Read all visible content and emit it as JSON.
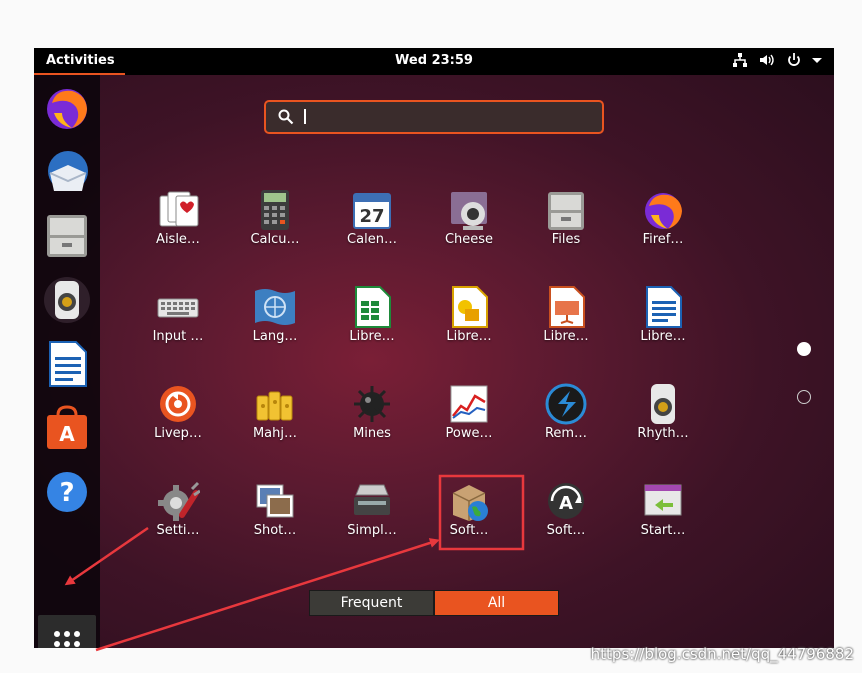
{
  "topbar": {
    "activities": "Activities",
    "clock": "Wed 23:59",
    "icons": [
      "network-icon",
      "volume-icon",
      "power-icon",
      "chevron-down-icon"
    ]
  },
  "dock": {
    "items": [
      "firefox-icon",
      "thunderbird-icon",
      "files-icon",
      "rhythmbox-icon",
      "libreoffice-writer-icon",
      "software-center-icon",
      "help-icon"
    ],
    "show_apps": "show-applications-grid-icon"
  },
  "search": {
    "placeholder": "",
    "value": ""
  },
  "apps": [
    {
      "label": "Aisle…",
      "icon": "aisleriot-icon"
    },
    {
      "label": "Calcu…",
      "icon": "calculator-icon"
    },
    {
      "label": "Calen…",
      "icon": "calendar-icon",
      "badge": "27"
    },
    {
      "label": "Cheese",
      "icon": "cheese-icon"
    },
    {
      "label": "Files",
      "icon": "files-icon"
    },
    {
      "label": "Firef…",
      "icon": "firefox-icon"
    },
    {
      "label": "Input …",
      "icon": "keyboard-icon"
    },
    {
      "label": "Lang…",
      "icon": "language-icon"
    },
    {
      "label": "Libre…",
      "icon": "libreoffice-calc-icon"
    },
    {
      "label": "Libre…",
      "icon": "libreoffice-draw-icon"
    },
    {
      "label": "Libre…",
      "icon": "libreoffice-impress-icon"
    },
    {
      "label": "Libre…",
      "icon": "libreoffice-writer-icon"
    },
    {
      "label": "Livep…",
      "icon": "livepatch-icon"
    },
    {
      "label": "Mahj…",
      "icon": "mahjongg-icon"
    },
    {
      "label": "Mines",
      "icon": "mines-icon"
    },
    {
      "label": "Powe…",
      "icon": "power-statistics-icon"
    },
    {
      "label": "Rem…",
      "icon": "remmina-icon"
    },
    {
      "label": "Rhyth…",
      "icon": "rhythmbox-icon"
    },
    {
      "label": "Setti…",
      "icon": "settings-icon"
    },
    {
      "label": "Shot…",
      "icon": "shotwell-icon"
    },
    {
      "label": "Simpl…",
      "icon": "simple-scan-icon"
    },
    {
      "label": "Soft…",
      "icon": "software-properties-icon"
    },
    {
      "label": "Soft…",
      "icon": "software-updater-icon"
    },
    {
      "label": "Start…",
      "icon": "startup-disk-icon"
    }
  ],
  "tabs": {
    "frequent": "Frequent",
    "all": "All",
    "active": "All"
  },
  "pages": {
    "current": 1,
    "total": 2
  },
  "watermark": "https://blog.csdn.net/qq_44796882",
  "colors": {
    "accent": "#e95420",
    "annotation": "#e8383d"
  }
}
